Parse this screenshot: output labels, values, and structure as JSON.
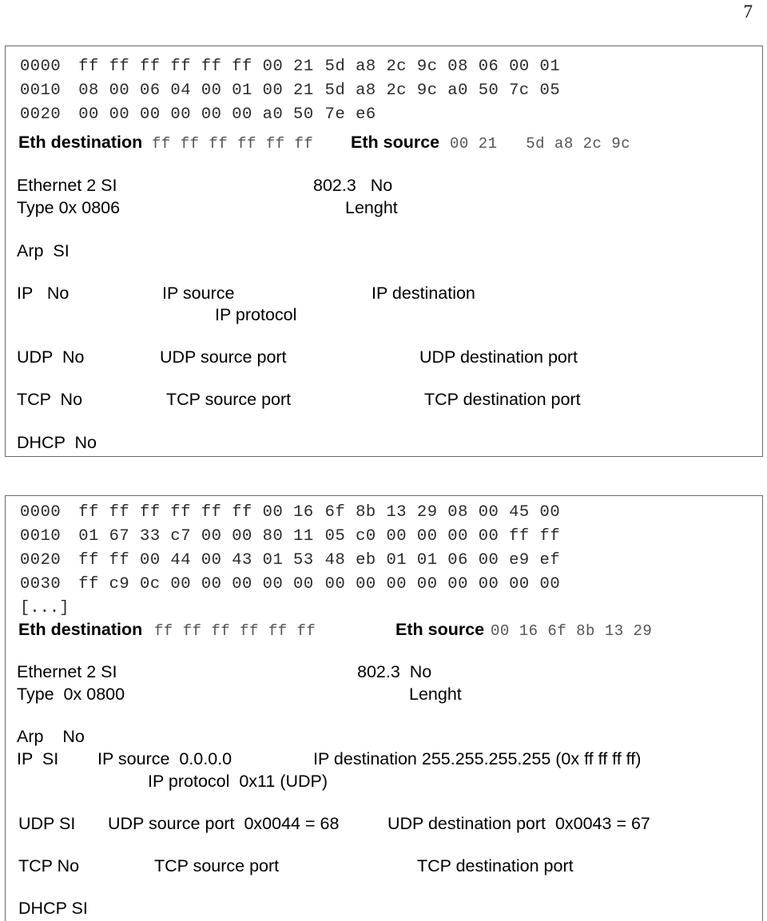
{
  "page": {
    "number": "7"
  },
  "arp_panel": {
    "hexdump": [
      {
        "offset": "0000",
        "left": "ff ff ff ff ff ff 00 21",
        "right": "5d a8 2c 9c 08 06 00 01"
      },
      {
        "offset": "0010",
        "left": "08 00 06 04 00 01 00 21",
        "right": "5d a8 2c 9c a0 50 7c 05"
      },
      {
        "offset": "0020",
        "left": "00 00 00 00 00 00 a0 50",
        "right": "7e e6"
      }
    ],
    "eth_destination_label": "Eth destination",
    "eth_destination_value": "ff ff ff ff ff ff",
    "eth_source_label": "Eth source",
    "eth_source_value": "00 21   5d a8 2c 9c",
    "ethernet2_label": "Ethernet 2 SI",
    "type_label": "Type 0x 0806",
    "dot3_label": "802.3   No",
    "lenght_label": "Lenght",
    "arp_label": "Arp  SI",
    "ip_label": "IP   No",
    "ip_source_label": "IP source",
    "ip_destination_label": "IP destination",
    "ip_protocol_label": "IP protocol",
    "udp_label": "UDP  No",
    "udp_source_port_label": "UDP source port",
    "udp_destination_port_label": "UDP destination port",
    "tcp_label": "TCP  No",
    "tcp_source_port_label": "TCP source port",
    "tcp_destination_port_label": "TCP destination port",
    "dhcp_label": "DHCP  No"
  },
  "dhcp_panel": {
    "hexdump": [
      {
        "offset": "0000",
        "left": "ff ff ff ff ff ff 00 16",
        "right": "6f 8b 13 29 08 00 45 00"
      },
      {
        "offset": "0010",
        "left": "01 67 33 c7 00 00 80 11",
        "right": "05 c0 00 00 00 00 ff ff"
      },
      {
        "offset": "0020",
        "left": "ff ff 00 44 00 43 01 53",
        "right": "48 eb 01 01 06 00 e9 ef"
      },
      {
        "offset": "0030",
        "left": "ff c9 0c 00 00 00 00 00",
        "right": "00 00 00 00 00 00 00 00"
      }
    ],
    "hexdump_continuation": "[...]",
    "eth_destination_label": "Eth destination",
    "eth_destination_value": "ff ff ff ff ff ff",
    "eth_source_label": "Eth source",
    "eth_source_value": "00 16 6f 8b 13 29",
    "ethernet2_label": "Ethernet 2 SI",
    "type_label": "Type  0x 0800",
    "dot3_label": "802.3  No",
    "lenght_label": "Lenght",
    "arp_label": "Arp    No",
    "ip_label": "IP  SI",
    "ip_source_label": "IP source  0.0.0.0",
    "ip_destination_label": "IP destination 255.255.255.255 (0x ff ff ff ff)",
    "ip_protocol_label": "IP protocol  0x11 (UDP)",
    "udp_label": "UDP SI",
    "udp_source_port_label": "UDP source port  0x0044 = 68",
    "udp_destination_port_label": "UDP destination port  0x0043 = 67",
    "tcp_label": "TCP No",
    "tcp_source_port_label": "TCP source port",
    "tcp_destination_port_label": "TCP destination port",
    "dhcp_label": "DHCP SI"
  }
}
